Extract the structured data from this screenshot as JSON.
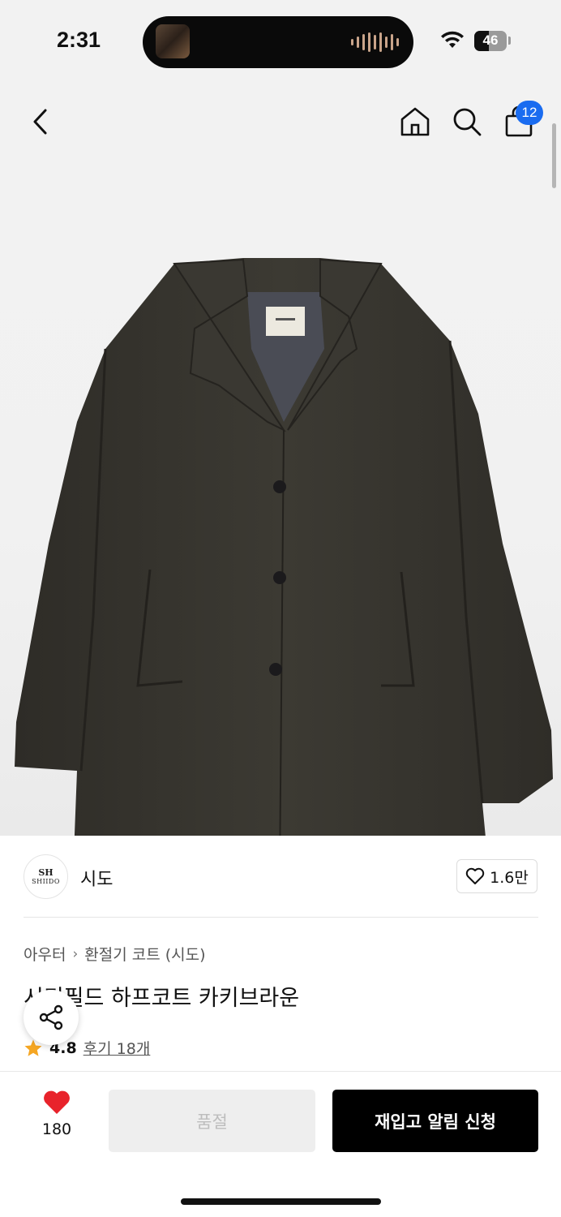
{
  "status_bar": {
    "time": "2:31",
    "battery": "46",
    "battery_level": 0.46
  },
  "header": {
    "cart_badge": "12"
  },
  "brand": {
    "logo_mark": "SH",
    "logo_text": "SHIIDO",
    "name": "시도",
    "likes": "1.6만"
  },
  "product": {
    "breadcrumb": [
      "아우터",
      "환절기 코트 (시도)"
    ],
    "title": "시티필드 하프코트 카키브라운",
    "rating": "4.8",
    "reviews": "후기 18개",
    "label_tag": "SHIIDO"
  },
  "actions": {
    "wish_count": "180",
    "soldout_label": "품절",
    "restock_label": "재입고 알림 신청"
  },
  "colors": {
    "accent_blue": "#1a6cf0",
    "heart_red": "#e8232b",
    "star_orange": "#f5a623",
    "primary_black": "#000000"
  },
  "icons": [
    "back-icon",
    "home-icon",
    "search-icon",
    "cart-icon",
    "expand-icon",
    "heart-outline-icon",
    "share-icon",
    "star-icon",
    "heart-icon",
    "wifi-icon"
  ]
}
